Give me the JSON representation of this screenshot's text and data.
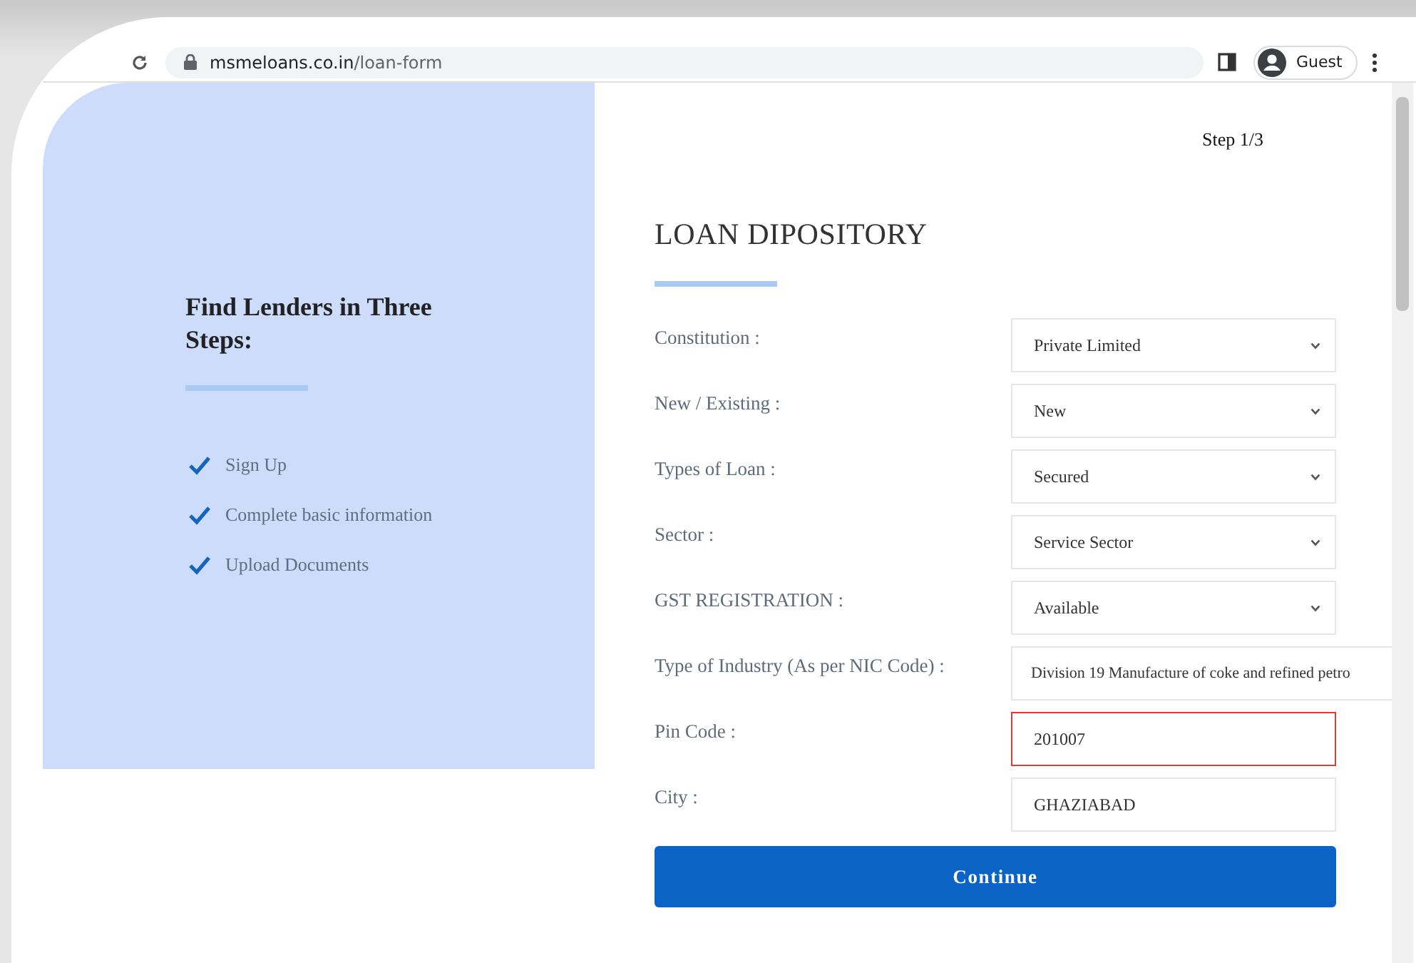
{
  "browser": {
    "url_domain": "msmeloans.co.in",
    "url_path": "/loan-form",
    "profile": "Guest"
  },
  "sidebar": {
    "heading": "Find Lenders in Three Steps:",
    "steps": [
      {
        "label": "Sign Up",
        "checked": true
      },
      {
        "label": "Complete basic information",
        "checked": true
      },
      {
        "label": "Upload Documents",
        "checked": true
      }
    ]
  },
  "form": {
    "step": "Step 1/3",
    "title": "LOAN DIPOSITORY",
    "fields": [
      {
        "label": "Constitution :",
        "kind": "select",
        "value": "Private Limited",
        "invalid": false
      },
      {
        "label": "New / Existing :",
        "kind": "select",
        "value": "New",
        "invalid": false
      },
      {
        "label": "Types of Loan :",
        "kind": "select",
        "value": "Secured",
        "invalid": false
      },
      {
        "label": "Sector :",
        "kind": "select",
        "value": "Service Sector",
        "invalid": false
      },
      {
        "label": "GST REGISTRATION :",
        "kind": "select",
        "value": "Available",
        "invalid": false
      },
      {
        "label": "Type of Industry (As per NIC Code) :",
        "kind": "wide-select",
        "value": "Division 19 Manufacture of coke and refined petro",
        "invalid": false
      },
      {
        "label": "Pin Code :",
        "kind": "text",
        "value": "201007",
        "invalid": true
      },
      {
        "label": "City :",
        "kind": "text",
        "value": "GHAZIABAD",
        "invalid": false
      }
    ],
    "submit": "Continue"
  }
}
